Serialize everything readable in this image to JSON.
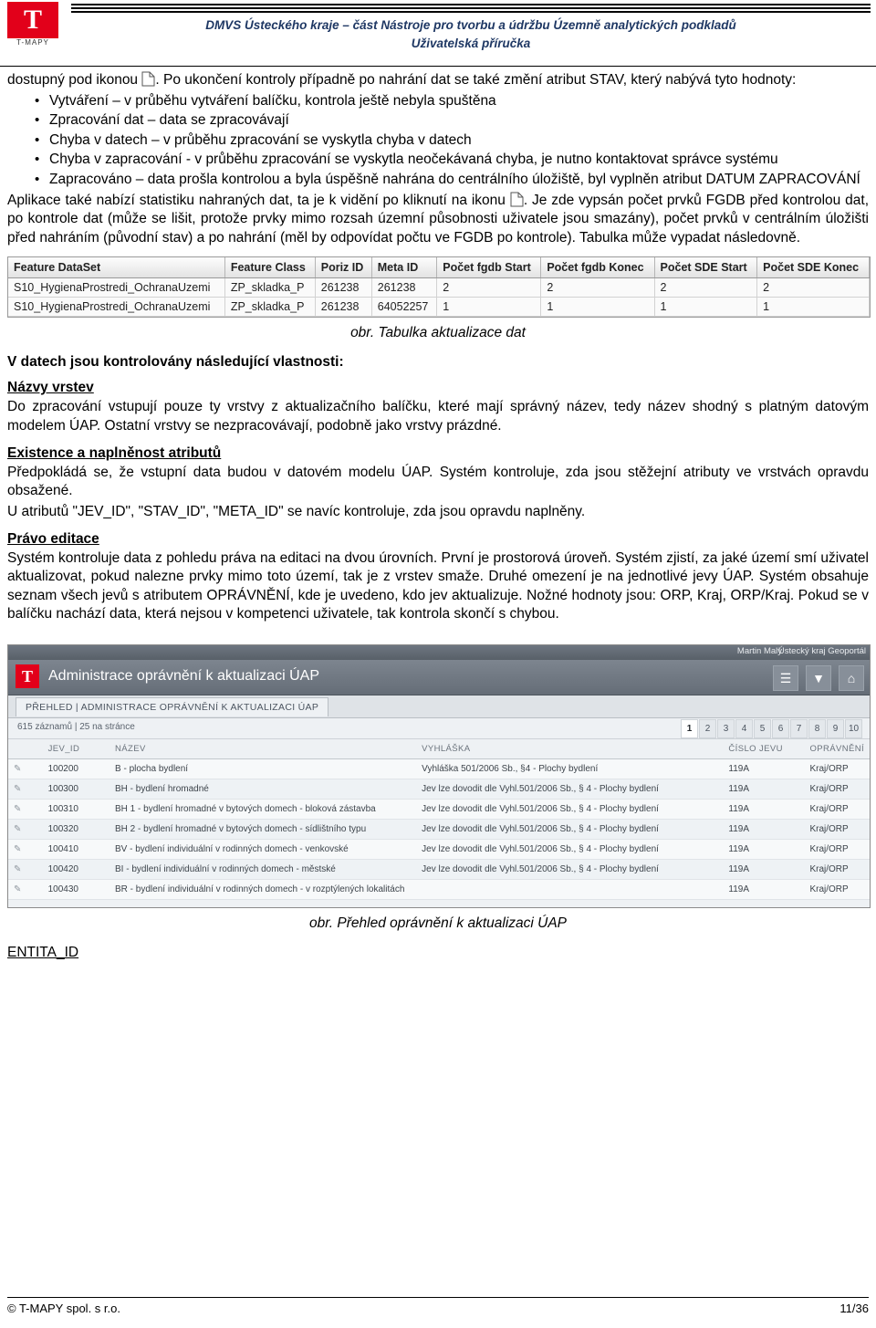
{
  "header": {
    "logo_letter": "T",
    "logo_label": "T-MAPY",
    "title": "DMVS Ústeckého kraje – část Nástroje pro tvorbu a údržbu Územně analytických podkladů",
    "subtitle": "Uživatelská příručka"
  },
  "body": {
    "intro_before_icon": "dostupný pod ikonou",
    "intro_after_icon": ". Po ukončení kontroly případně po nahrání dat se také změní atribut STAV, který nabývá tyto hodnoty:",
    "bullets": [
      "Vytváření – v průběhu vytváření balíčku, kontrola ještě nebyla spuštěna",
      "Zpracování dat – data se zpracovávají",
      "Chyba v datech – v průběhu zpracování se vyskytla chyba v datech",
      "Chyba  v zapracování - v průběhu zpracování se vyskytla neočekávaná chyba, je nutno kontaktovat správce systému",
      "Zapracováno – data prošla kontrolou a byla úspěšně nahrána do centrálního úložiště, byl vyplněn atribut DATUM ZAPRACOVÁNÍ"
    ],
    "stat_before_icon": "Aplikace také nabízí statistiku nahraných dat, ta je k vidění po kliknutí na ikonu",
    "stat_after_icon": ". Je zde vypsán počet prvků FGDB před kontrolou dat, po kontrole dat (může se lišit, protože prvky mimo rozsah územní působnosti uživatele jsou smazány), počet prvků v centrálním úložišti před nahráním (původní stav) a po nahrání (měl by odpovídat počtu ve FGDB po kontrole). Tabulka může vypadat následovně.",
    "fig1_caption": "obr. Tabulka aktualizace dat",
    "section_props_title": "V datech jsou kontrolovány následující vlastnosti:",
    "sec1_title": "Názvy vrstev",
    "sec1_text": "Do zpracování vstupují pouze ty vrstvy z aktualizačního balíčku, které mají správný název, tedy název shodný s platným datovým modelem ÚAP. Ostatní vrstvy se nezpracovávají, podobně jako vrstvy prázdné.",
    "sec2_title": "Existence a naplněnost atributů",
    "sec2_text_1": "Předpokládá se, že vstupní data budou v datovém modelu ÚAP. Systém kontroluje, zda jsou stěžejní atributy ve vrstvách opravdu obsažené.",
    "sec2_text_2": "U atributů \"JEV_ID\", \"STAV_ID\", \"META_ID\" se navíc kontroluje, zda jsou opravdu naplněny.",
    "sec3_title": "Právo editace",
    "sec3_text": "Systém kontroluje data z pohledu práva na editaci na dvou úrovních. První je prostorová úroveň. Systém zjistí, za jaké území smí uživatel aktualizovat, pokud nalezne prvky mimo toto území, tak je z vrstev smaže. Druhé omezení je na jednotlivé jevy ÚAP. Systém obsahuje seznam všech jevů s atributem OPRÁVNĚNÍ, kde je uvedeno, kdo jev aktualizuje. Nožné hodnoty jsou: ORP, Kraj, ORP/Kraj. Pokud se v balíčku nachází data, která nejsou v kompetenci uživatele, tak kontrola skončí s chybou.",
    "fig2_caption": "obr. Přehled oprávnění k aktualizaci ÚAP",
    "entita_heading": "ENTITA_ID"
  },
  "fig1_table": {
    "columns": [
      "Feature DataSet",
      "Feature Class",
      "Poriz ID",
      "Meta ID",
      "Počet fgdb Start",
      "Počet fgdb Konec",
      "Počet SDE Start",
      "Počet SDE Konec"
    ],
    "rows": [
      [
        "S10_HygienaProstredi_OchranaUzemi",
        "ZP_skladka_P",
        "261238",
        "261238",
        "2",
        "2",
        "2",
        "2"
      ],
      [
        "S10_HygienaProstredi_OchranaUzemi",
        "ZP_skladka_P",
        "261238",
        "64052257",
        "1",
        "1",
        "1",
        "1"
      ]
    ]
  },
  "app": {
    "topbar_user": "Martin Malý",
    "topbar_portal": "Ústecký kraj Geoportál",
    "logo_letter": "T",
    "title": "Administrace oprávnění k aktualizaci ÚAP",
    "tools": [
      "list-icon",
      "filter-icon",
      "home-icon"
    ],
    "tab_label": "PŘEHLED | ADMINISTRACE OPRÁVNĚNÍ K AKTUALIZACI ÚAP",
    "records_info": "615 záznamů | 25 na stránce",
    "pager": [
      "1",
      "2",
      "3",
      "4",
      "5",
      "6",
      "7",
      "8",
      "9",
      "10"
    ],
    "pager_active": "1",
    "columns": [
      "JEV_ID",
      "NÁZEV",
      "VYHLÁŠKA",
      "ČÍSLO JEVU",
      "OPRÁVNĚNÍ"
    ],
    "rows": [
      {
        "jev_id": "100200",
        "nazev": "B - plocha bydlení",
        "vyhlaska": "Vyhláška 501/2006 Sb., §4 - Plochy bydlení",
        "cislo": "119A",
        "opravneni": "Kraj/ORP"
      },
      {
        "jev_id": "100300",
        "nazev": "BH - bydlení hromadné",
        "vyhlaska": "Jev lze dovodit dle Vyhl.501/2006 Sb., § 4 - Plochy bydlení",
        "cislo": "119A",
        "opravneni": "Kraj/ORP"
      },
      {
        "jev_id": "100310",
        "nazev": "BH 1 - bydlení hromadné v bytových domech - bloková zástavba",
        "vyhlaska": "Jev lze dovodit dle Vyhl.501/2006 Sb., § 4 - Plochy bydlení",
        "cislo": "119A",
        "opravneni": "Kraj/ORP"
      },
      {
        "jev_id": "100320",
        "nazev": "BH 2 - bydlení hromadné v bytových domech - sídlištního typu",
        "vyhlaska": "Jev lze dovodit dle Vyhl.501/2006 Sb., § 4 - Plochy bydlení",
        "cislo": "119A",
        "opravneni": "Kraj/ORP"
      },
      {
        "jev_id": "100410",
        "nazev": "BV - bydlení individuální v rodinných domech - venkovské",
        "vyhlaska": "Jev lze dovodit dle Vyhl.501/2006 Sb., § 4 - Plochy bydlení",
        "cislo": "119A",
        "opravneni": "Kraj/ORP"
      },
      {
        "jev_id": "100420",
        "nazev": "BI - bydlení individuální v rodinných domech - městské",
        "vyhlaska": "Jev lze dovodit dle Vyhl.501/2006 Sb., § 4 - Plochy bydlení",
        "cislo": "119A",
        "opravneni": "Kraj/ORP"
      },
      {
        "jev_id": "100430",
        "nazev": "BR - bydlení individuální v rodinných domech - v rozptýlených lokalitách",
        "vyhlaska": "",
        "cislo": "119A",
        "opravneni": "Kraj/ORP"
      }
    ]
  },
  "footer": {
    "left": "© T-MAPY spol. s r.o.",
    "right": "11/36"
  }
}
